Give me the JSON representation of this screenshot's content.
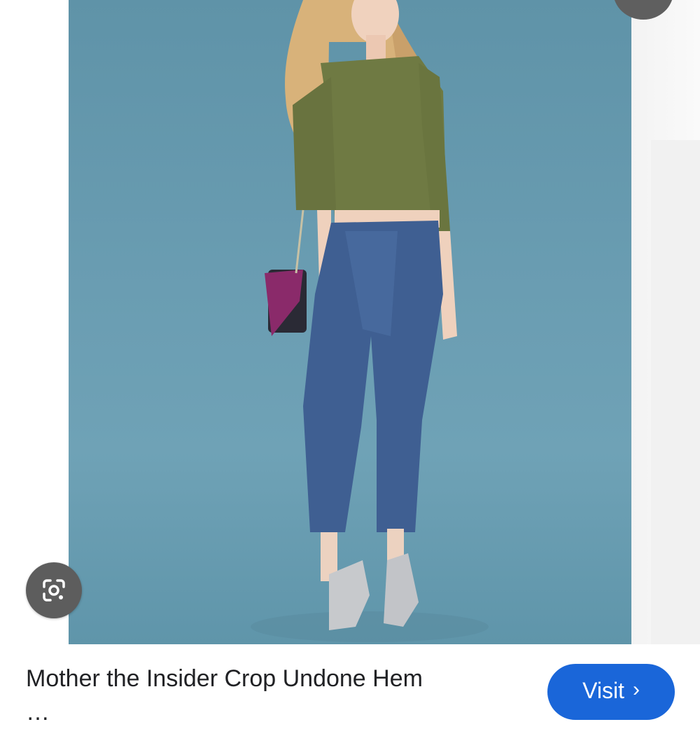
{
  "product": {
    "title_line1": "Mother the Insider Crop Undone Hem",
    "title_line2": "…"
  },
  "actions": {
    "visit_label": "Visit",
    "visit_chevron": "›"
  },
  "icons": {
    "lens": "google-lens-icon",
    "top_button": "more-icon"
  },
  "colors": {
    "visit_button": "#1a66d9",
    "photo_background": "#6a9db2",
    "overlay_button": "#5d5d5d"
  }
}
